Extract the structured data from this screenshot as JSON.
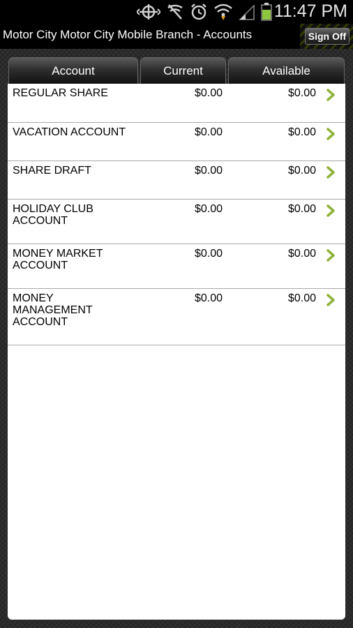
{
  "status_bar": {
    "time": "11:47 PM",
    "icons": [
      "gps-icon",
      "nfc-icon",
      "signal-blocked-icon",
      "alarm-icon",
      "wifi-icon",
      "cell-signal-icon",
      "battery-icon"
    ]
  },
  "header": {
    "title": "Motor City Motor City Mobile Branch - Accounts",
    "sign_off_label": "Sign Off"
  },
  "columns": {
    "account": "Account",
    "current": "Current",
    "available": "Available"
  },
  "accounts": [
    {
      "name": "REGULAR SHARE",
      "current": "$0.00",
      "available": "$0.00"
    },
    {
      "name": "VACATION ACCOUNT",
      "current": "$0.00",
      "available": "$0.00"
    },
    {
      "name": "SHARE DRAFT",
      "current": "$0.00",
      "available": "$0.00"
    },
    {
      "name": "HOLIDAY CLUB ACCOUNT",
      "current": "$0.00",
      "available": "$0.00"
    },
    {
      "name": "MONEY MARKET ACCOUNT",
      "current": "$0.00",
      "available": "$0.00"
    },
    {
      "name": "MONEY MANAGEMENT ACCOUNT",
      "current": "$0.00",
      "available": "$0.00"
    }
  ],
  "colors": {
    "chevron": "#8db33a",
    "accent_stripe": "#2f3a00"
  }
}
